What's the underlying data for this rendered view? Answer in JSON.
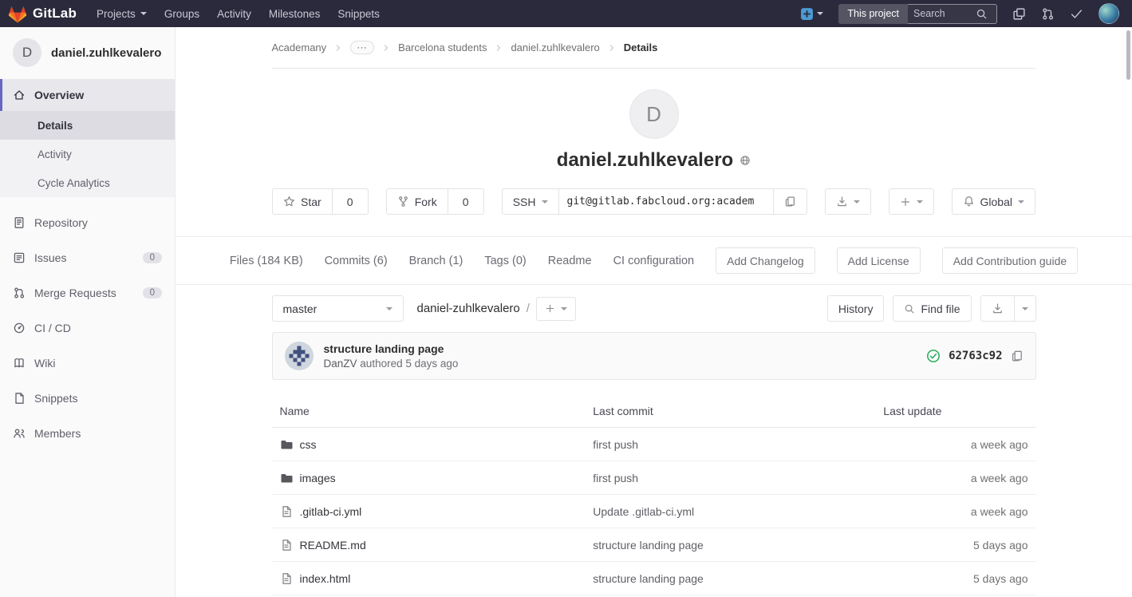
{
  "navbar": {
    "brand": "GitLab",
    "items": [
      {
        "label": "Projects"
      },
      {
        "label": "Groups"
      },
      {
        "label": "Activity"
      },
      {
        "label": "Milestones"
      },
      {
        "label": "Snippets"
      }
    ],
    "scope_label": "This project",
    "search_placeholder": "Search"
  },
  "sidebar": {
    "project_initial": "D",
    "project_name": "daniel.zuhlkevalero",
    "items": [
      {
        "label": "Overview"
      },
      {
        "label": "Details"
      },
      {
        "label": "Activity"
      },
      {
        "label": "Cycle Analytics"
      },
      {
        "label": "Repository"
      },
      {
        "label": "Issues",
        "count": "0"
      },
      {
        "label": "Merge Requests",
        "count": "0"
      },
      {
        "label": "CI / CD"
      },
      {
        "label": "Wiki"
      },
      {
        "label": "Snippets"
      },
      {
        "label": "Members"
      }
    ]
  },
  "breadcrumb": {
    "items": [
      {
        "label": "Academany"
      },
      {
        "label": "⋯"
      },
      {
        "label": "Barcelona students"
      },
      {
        "label": "daniel.zuhlkevalero"
      },
      {
        "label": "Details"
      }
    ]
  },
  "project_header": {
    "initial": "D",
    "title": "daniel.zuhlkevalero",
    "star_label": "Star",
    "star_count": "0",
    "fork_label": "Fork",
    "fork_count": "0",
    "protocol": "SSH",
    "clone_url": "git@gitlab.fabcloud.org:academ",
    "global_label": "Global"
  },
  "project_nav": {
    "tabs": [
      {
        "label": "Files (184 KB)"
      },
      {
        "label": "Commits (6)"
      },
      {
        "label": "Branch (1)"
      },
      {
        "label": "Tags (0)"
      },
      {
        "label": "Readme"
      },
      {
        "label": "CI configuration"
      }
    ],
    "buttons": [
      {
        "label": "Add Changelog"
      },
      {
        "label": "Add License"
      },
      {
        "label": "Add Contribution guide"
      }
    ]
  },
  "tree_toolbar": {
    "branch": "master",
    "path": "daniel-zuhlkevalero",
    "path_separator": "/",
    "history_label": "History",
    "find_file_label": "Find file"
  },
  "last_commit": {
    "title": "structure landing page",
    "author": "DanZV",
    "authored_text": "authored 5 days ago",
    "sha": "62763c92"
  },
  "tree_table": {
    "headers": [
      {
        "label": "Name"
      },
      {
        "label": "Last commit"
      },
      {
        "label": "Last update"
      }
    ],
    "rows": [
      {
        "name": "css",
        "type": "folder",
        "commit": "first push",
        "updated": "a week ago"
      },
      {
        "name": "images",
        "type": "folder",
        "commit": "first push",
        "updated": "a week ago"
      },
      {
        "name": ".gitlab-ci.yml",
        "type": "file",
        "commit": "Update .gitlab-ci.yml",
        "updated": "a week ago"
      },
      {
        "name": "README.md",
        "type": "file",
        "commit": "structure landing page",
        "updated": "5 days ago"
      },
      {
        "name": "index.html",
        "type": "file",
        "commit": "structure landing page",
        "updated": "5 days ago"
      }
    ]
  }
}
